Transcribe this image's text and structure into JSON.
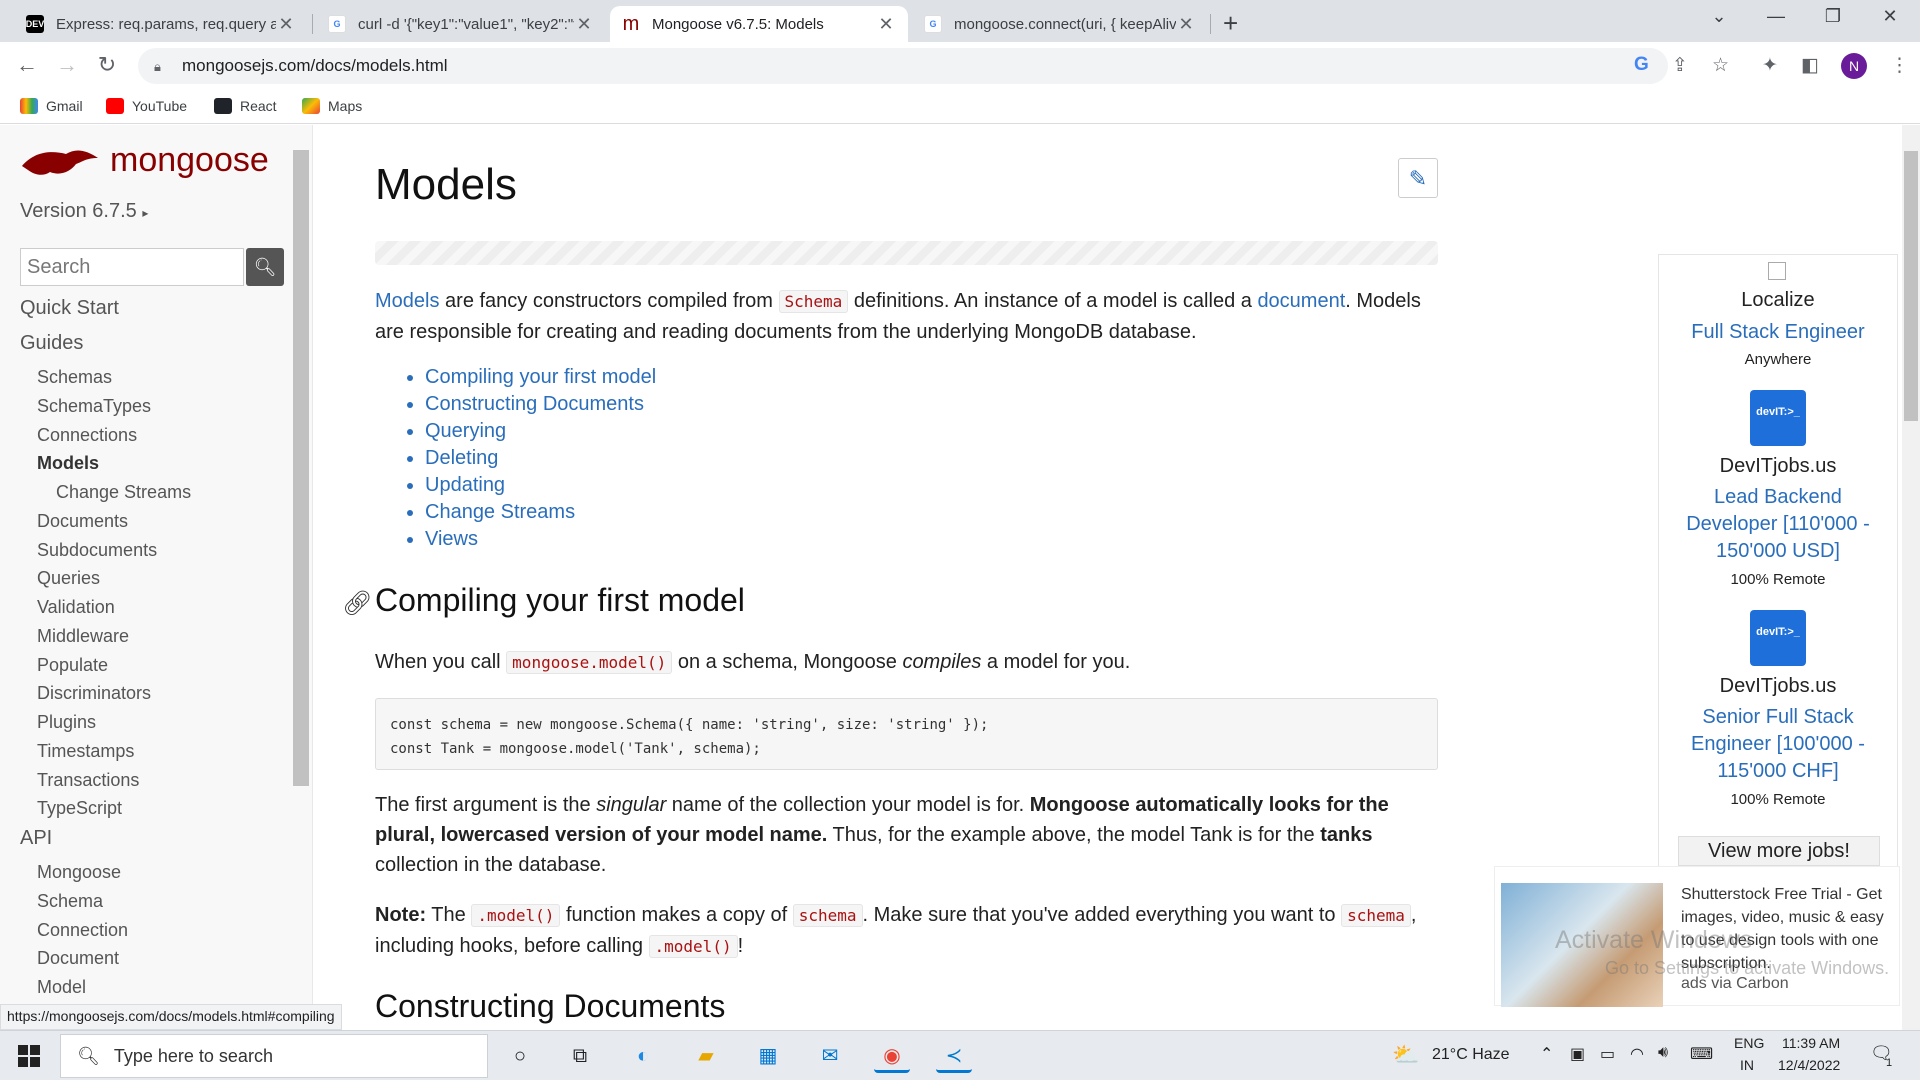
{
  "tabs": [
    {
      "title": "Express: req.params, req.query ar",
      "favicon": "DEV"
    },
    {
      "title": "curl -d '{\"key1\":\"value1\", \"key2\":\"v",
      "favicon": "G"
    },
    {
      "title": "Mongoose v6.7.5: Models",
      "favicon": "m"
    },
    {
      "title": "mongoose.connect(uri, { keepAliv",
      "favicon": "G"
    }
  ],
  "address": "mongoosejs.com/docs/models.html",
  "profile_initial": "N",
  "bookmarks": [
    "Gmail",
    "YouTube",
    "React",
    "Maps"
  ],
  "sidebar": {
    "logo": "mongoose",
    "version": "Version 6.7.5",
    "search_placeholder": "Search",
    "quick_start": "Quick Start",
    "guides": "Guides",
    "guide_items": [
      "Schemas",
      "SchemaTypes",
      "Connections",
      "Models",
      "Change Streams",
      "Documents",
      "Subdocuments",
      "Queries",
      "Validation",
      "Middleware",
      "Populate",
      "Discriminators",
      "Plugins",
      "Timestamps",
      "Transactions",
      "TypeScript"
    ],
    "api": "API",
    "api_items": [
      "Mongoose",
      "Schema",
      "Connection",
      "Document",
      "Model"
    ]
  },
  "status_url": "https://mongoosejs.com/docs/models.html#compiling",
  "content": {
    "title": "Models",
    "intro_link1": "Models",
    "intro_t1": " are fancy constructors compiled from ",
    "intro_code": "Schema",
    "intro_t2": " definitions. An instance of a model is called a ",
    "intro_link2": "document",
    "intro_t3": ". Models are responsible for creating and reading documents from the underlying MongoDB database.",
    "toc": [
      "Compiling your first model",
      "Constructing Documents",
      "Querying",
      "Deleting",
      "Updating",
      "Change Streams",
      "Views"
    ],
    "h2_compiling": "Compiling your first model",
    "p_call_1": "When you call ",
    "p_call_code": "mongoose.model()",
    "p_call_2": " on a schema, Mongoose ",
    "p_call_em": "compiles",
    "p_call_3": " a model for you.",
    "code_line1": "const schema = new mongoose.Schema({ name: 'string', size: 'string' });",
    "code_line2": "const Tank = mongoose.model('Tank', schema);",
    "p_first_1": "The first argument is the ",
    "p_first_em": "singular",
    "p_first_2": " name of the collection your model is for. ",
    "p_first_bold": "Mongoose automatically looks for the plural, lowercased version of your model name.",
    "p_first_3": " Thus, for the example above, the model Tank is for the ",
    "p_first_bold2": "tanks",
    "p_first_4": " collection in the database.",
    "note_label": "Note:",
    "note_1": " The ",
    "note_code1": ".model()",
    "note_2": " function makes a copy of ",
    "note_code2": "schema",
    "note_3": ". Make sure that you've added everything you want to ",
    "note_code3": "schema",
    "note_4": ", including hooks, before calling ",
    "note_code4": ".model()",
    "note_5": "!",
    "h2_constructing": "Constructing Documents"
  },
  "jobs": {
    "job1_company": "Localize",
    "job1_title": "Full Stack Engineer",
    "job1_location": "Anywhere",
    "job2_company": "DevITjobs.us",
    "job2_title": "Lead Backend Developer [110'000 - 150'000 USD]",
    "job2_location": "100% Remote",
    "job3_company": "DevITjobs.us",
    "job3_title": "Senior Full Stack Engineer [100'000 - 115'000 CHF]",
    "job3_location": "100% Remote",
    "logo_text": "devIT:>_",
    "view_more": "View more jobs!"
  },
  "carbon": {
    "text": "Shutterstock Free Trial - Get images, video, music & easy to use design tools with one subscription.",
    "via": "ads via Carbon"
  },
  "watermark": {
    "line1": "Activate Windows",
    "line2": "Go to Settings to activate Windows."
  },
  "taskbar": {
    "search_placeholder": "Type here to search",
    "weather": "21°C  Haze",
    "lang1": "ENG",
    "lang2": "IN",
    "time": "11:39 AM",
    "date": "12/4/2022",
    "notif_count": "1"
  },
  "colors": {
    "brand": "#880000",
    "link": "#2a6ebb",
    "tab_bar": "#dee1e6"
  }
}
